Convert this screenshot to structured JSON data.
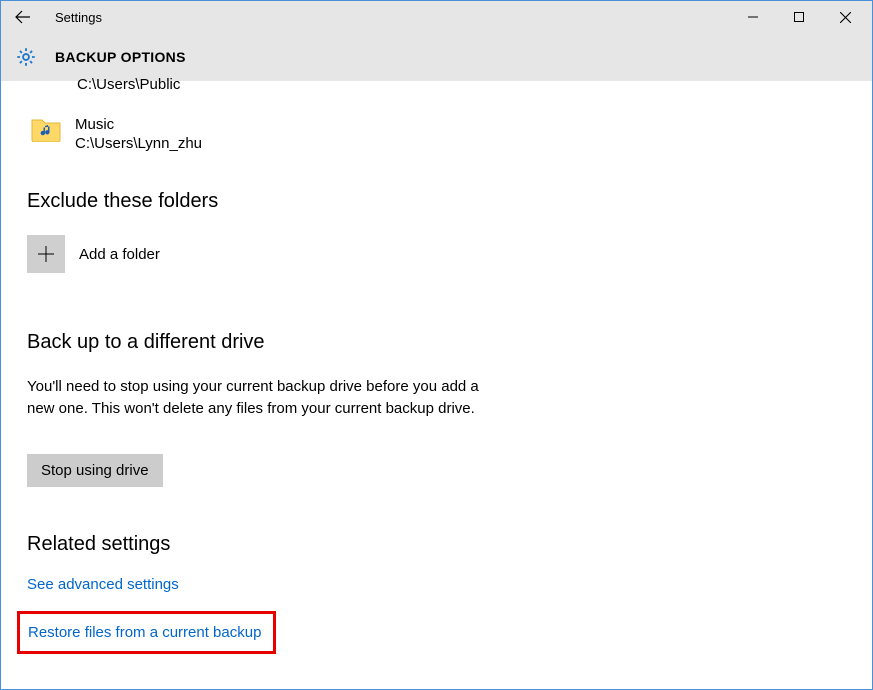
{
  "titlebar": {
    "title": "Settings"
  },
  "header": {
    "page_title": "BACKUP OPTIONS"
  },
  "truncated_prev_path": "C:\\Users\\Public",
  "folder": {
    "name": "Music",
    "path": "C:\\Users\\Lynn_zhu"
  },
  "sections": {
    "exclude_heading": "Exclude these folders",
    "add_folder_label": "Add a folder",
    "diff_drive_heading": "Back up to a different drive",
    "diff_drive_desc": "You'll need to stop using your current backup drive before you add a new one. This won't delete any files from your current backup drive.",
    "stop_button": "Stop using drive",
    "related_heading": "Related settings",
    "link_advanced": "See advanced settings",
    "link_restore": "Restore files from a current backup"
  }
}
